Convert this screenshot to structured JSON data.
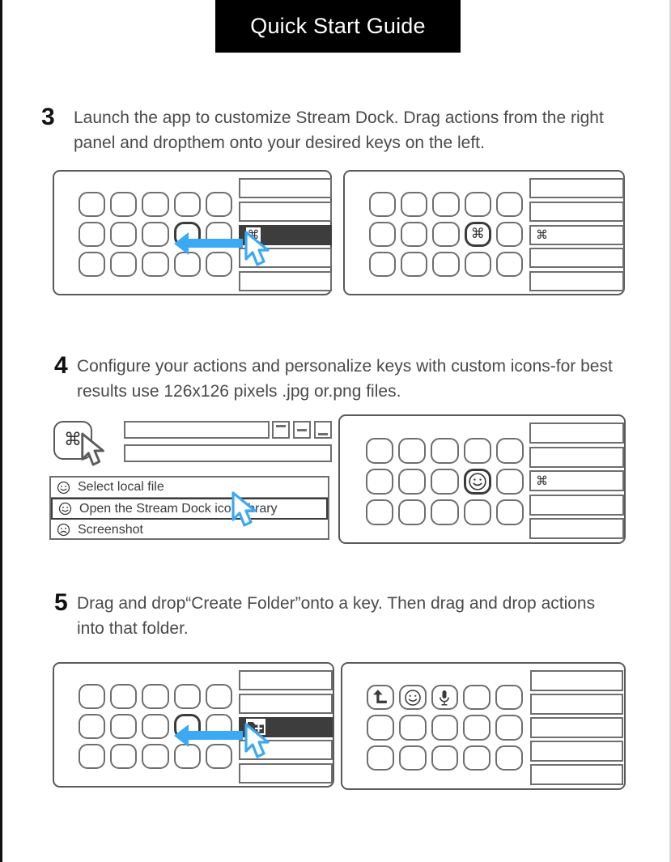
{
  "document": {
    "title": "Quick Start Guide"
  },
  "colors": {
    "banner_bg": "#000000",
    "banner_text": "#ffffff",
    "arrow_blue": "#3ba9f4",
    "cursor_blue": "#3ba9f4",
    "panel_highlight": "#3d3d3d",
    "outline": "#5a5a5a",
    "body_text": "#4a4a4a"
  },
  "steps": [
    {
      "number": "3",
      "text": "Launch the app to customize Stream Dock. Drag actions from the right panel and dropthem onto your desired keys on the left.",
      "figures": {
        "left": {
          "key_rows": 3,
          "key_cols": 5,
          "selected_key": {
            "row": 2,
            "col": 4
          },
          "selected_key_icon": "",
          "panel_rows": 5,
          "highlighted_panel_row": 3,
          "panel_row_icon": "command-glyph",
          "glyph": "⌘",
          "arrow": "drag-arrow-left",
          "cursor": "mouse-pointer"
        },
        "right": {
          "key_rows": 3,
          "key_cols": 5,
          "selected_key": {
            "row": 2,
            "col": 4
          },
          "selected_key_icon": "command-glyph",
          "panel_rows": 5,
          "panel_row_with_glyph": 3,
          "glyph": "⌘"
        }
      }
    },
    {
      "number": "4",
      "text": "Configure your actions and personalize keys with custom icons-for best results use 126x126 pixels .jpg or.png files.",
      "figures": {
        "left": {
          "key_glyph": "⌘",
          "key_icon_name": "command-key",
          "fields": [
            "",
            ""
          ],
          "align_icons": [
            "align-top-icon",
            "align-middle-icon",
            "align-bottom-icon"
          ],
          "menu_items": [
            {
              "icon": "smiley-icon",
              "label": "Select local file",
              "highlighted": false
            },
            {
              "icon": "smiley-icon",
              "label": "Open the Stream Dock icon library",
              "highlighted": true
            },
            {
              "icon": "frowny-icon",
              "label": "Screenshot",
              "highlighted": false
            }
          ],
          "cursor": "mouse-pointer"
        },
        "right": {
          "key_rows": 3,
          "key_cols": 5,
          "selected_key": {
            "row": 2,
            "col": 4
          },
          "selected_key_icon": "smiley-icon",
          "panel_rows": 5,
          "panel_row_with_glyph": 3,
          "glyph": "⌘"
        }
      }
    },
    {
      "number": "5",
      "text": "Drag and drop“Create Folder”onto a key. Then drag and drop actions into that folder.",
      "figures": {
        "left": {
          "key_rows": 3,
          "key_cols": 5,
          "selected_key": {
            "row": 2,
            "col": 4
          },
          "panel_rows": 5,
          "highlighted_panel_row": 3,
          "panel_row_icon": "create-folder-icon",
          "arrow": "drag-arrow-left",
          "cursor": "mouse-pointer"
        },
        "right": {
          "key_rows": 3,
          "key_cols": 5,
          "filled_keys": [
            {
              "row": 1,
              "col": 1,
              "icon": "back-arrow-icon"
            },
            {
              "row": 1,
              "col": 2,
              "icon": "smiley-icon"
            },
            {
              "row": 1,
              "col": 3,
              "icon": "microphone-icon"
            }
          ],
          "panel_rows": 5
        }
      }
    }
  ]
}
